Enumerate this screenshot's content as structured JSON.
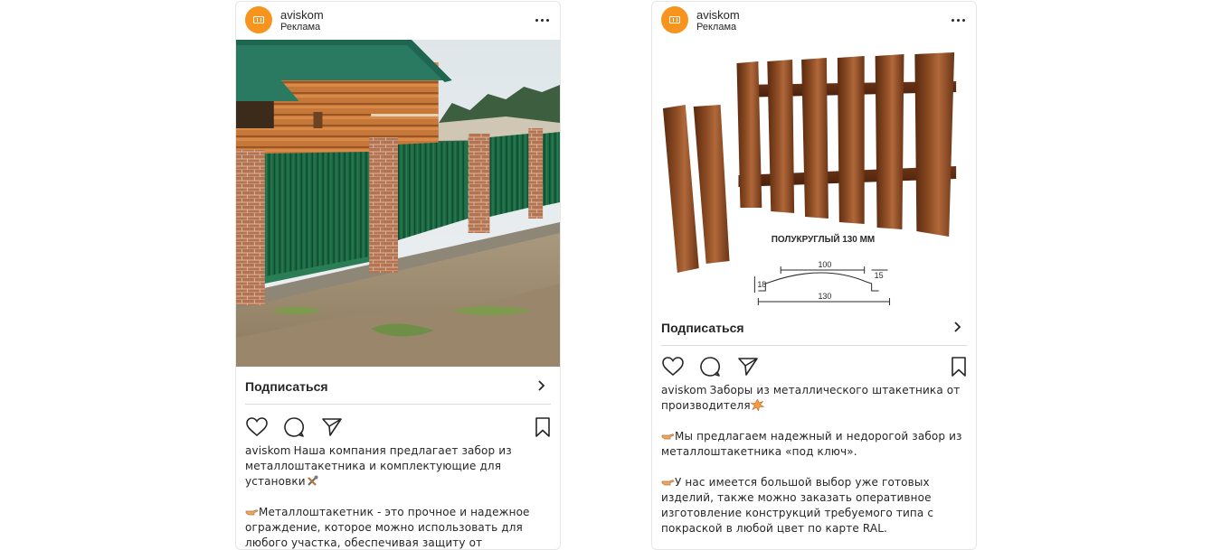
{
  "posts": [
    {
      "username": "aviskom",
      "sponsored_label": "Реклама",
      "cta_label": "Подписаться",
      "caption_username": "aviskom",
      "caption_paragraphs": [
        "Наша компания предлагает забор из металлоштакетника и комплектующие для установки",
        "Металлоштакетник - это прочное и надежное ограждение, которое можно использовать для любого участка, обеспечивая защиту от"
      ],
      "photo_description_icon": "green-metal-picket-fence-photo"
    },
    {
      "username": "aviskom",
      "sponsored_label": "Реклама",
      "cta_label": "Подписаться",
      "caption_username": "aviskom",
      "caption_paragraphs": [
        "Заборы из металлического штакетника от производителя",
        "Мы предлагаем надежный и недорогой забор из металлоштакетника «под ключ».",
        "У нас имеется большой выбор уже готовых изделий, также можно заказать оперативное изготовление конструкций требуемого типа с покраской в любой цвет по карте RAL."
      ],
      "diagram": {
        "title": "ПОЛУКРУГЛЫЙ 130 ММ",
        "dim_top": "100",
        "dim_right": "15",
        "dim_left": "18",
        "dim_bottom": "130"
      }
    }
  ],
  "icons": {
    "more": "more-dots-icon",
    "chevron": "chevron-right-icon",
    "like": "heart-icon",
    "comment": "comment-icon",
    "share": "share-icon",
    "save": "bookmark-icon",
    "hand": "pointing-hand-emoji",
    "tools": "tools-emoji",
    "boom": "collision-emoji"
  },
  "colors": {
    "avatar": "#f7941d",
    "fence_green": "#1f6b45",
    "picket_brown": "#7a3b1a"
  }
}
